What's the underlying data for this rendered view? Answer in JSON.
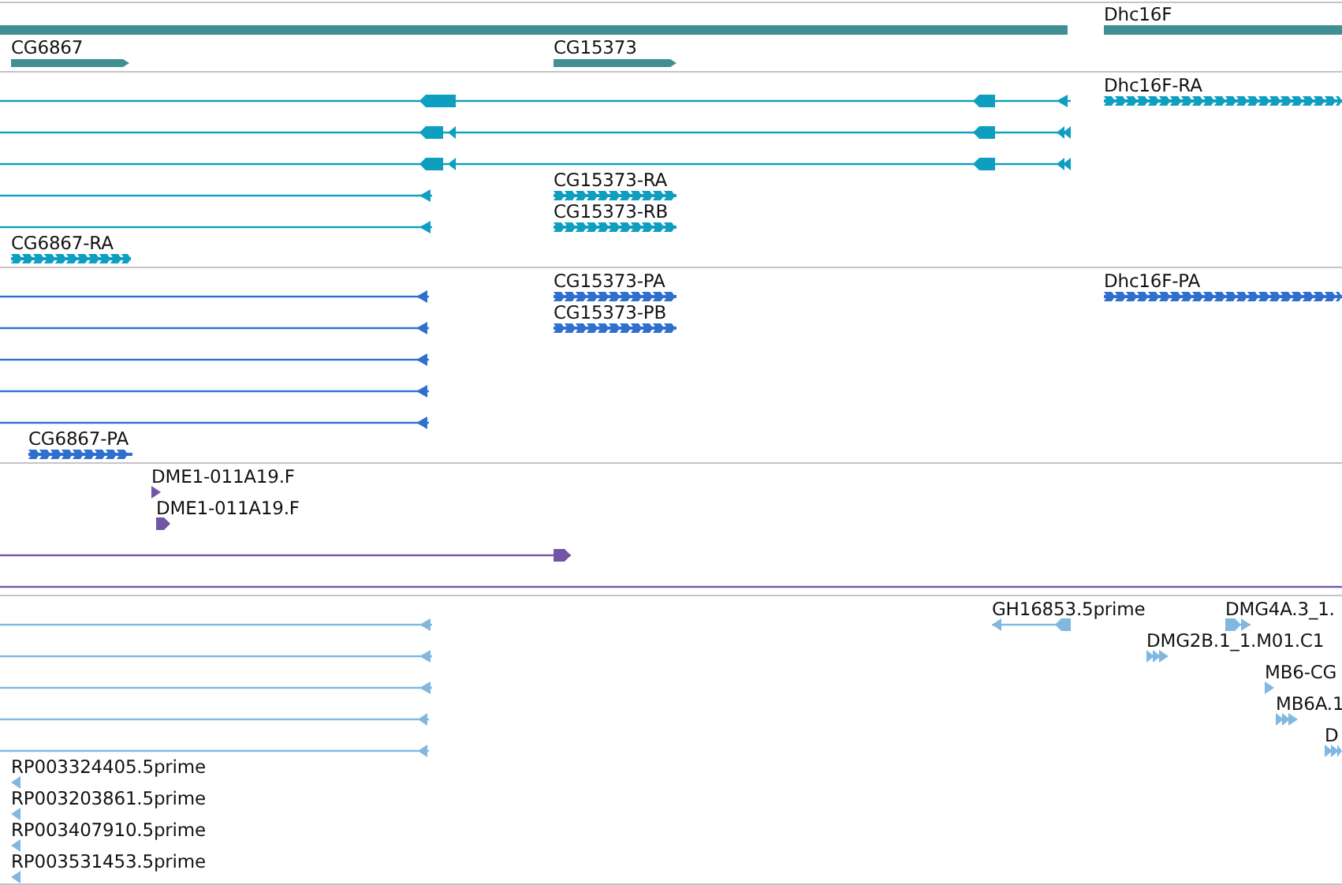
{
  "tracks": [
    {
      "color": "#3f8f93",
      "features": [
        {
          "kind": "gene"
        },
        {
          "kind": "gene",
          "label": "Dhc16F"
        },
        {
          "kind": "gene",
          "label": "CG6867"
        },
        {
          "kind": "gene",
          "label": "CG15373"
        }
      ]
    },
    {
      "color": "#0d9ec0",
      "features": [
        {
          "kind": "line"
        },
        {
          "kind": "transcript",
          "label": "Dhc16F-RA"
        },
        {
          "kind": "line"
        },
        {
          "kind": "line"
        },
        {
          "kind": "line"
        },
        {
          "kind": "transcript",
          "label": "CG15373-RA"
        },
        {
          "kind": "line"
        },
        {
          "kind": "transcript",
          "label": "CG15373-RB"
        },
        {
          "kind": "transcript",
          "label": "CG6867-RA"
        }
      ]
    },
    {
      "color": "#2f6fce",
      "features": [
        {
          "kind": "line"
        },
        {
          "kind": "transcript",
          "label": "CG15373-PA"
        },
        {
          "kind": "transcript",
          "label": "Dhc16F-PA"
        },
        {
          "kind": "line"
        },
        {
          "kind": "transcript",
          "label": "CG15373-PB"
        },
        {
          "kind": "line"
        },
        {
          "kind": "line"
        },
        {
          "kind": "line"
        },
        {
          "kind": "transcript",
          "label": "CG6867-PA"
        }
      ]
    },
    {
      "color": "#7355a8",
      "features": [
        {
          "kind": "read",
          "label": "DME1-011A19.F"
        },
        {
          "kind": "read",
          "label": "DME1-011A19.F"
        },
        {
          "kind": "line"
        },
        {
          "kind": "line"
        }
      ]
    },
    {
      "color": "#80b8e0",
      "features": [
        {
          "kind": "line"
        },
        {
          "kind": "read",
          "label": "GH16853.5prime"
        },
        {
          "kind": "read",
          "label": "DMG4A.3_1."
        },
        {
          "kind": "line"
        },
        {
          "kind": "read",
          "label": "DMG2B.1_1.M01.C1"
        },
        {
          "kind": "line"
        },
        {
          "kind": "read",
          "label": "MB6-CG"
        },
        {
          "kind": "line"
        },
        {
          "kind": "read",
          "label": "MB6A.1"
        },
        {
          "kind": "line"
        },
        {
          "kind": "read",
          "label": "D"
        },
        {
          "kind": "read",
          "label": "RP003324405.5prime"
        },
        {
          "kind": "read",
          "label": "RP003203861.5prime"
        },
        {
          "kind": "read",
          "label": "RP003407910.5prime"
        },
        {
          "kind": "read",
          "label": "RP003531453.5prime"
        }
      ]
    }
  ]
}
